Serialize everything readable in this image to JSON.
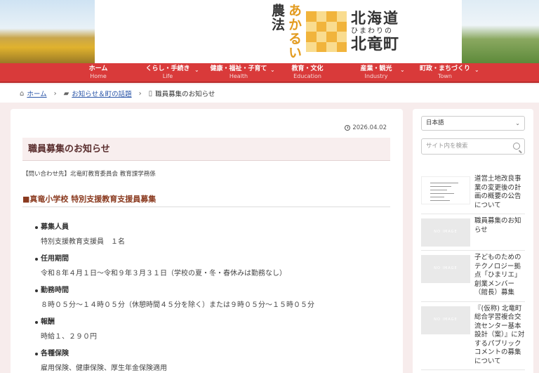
{
  "header": {
    "logo": {
      "vertical_right": "あかるい",
      "vertical_left": "農法",
      "pref": "北海道",
      "sub": "ひまわりの",
      "town": "北竜町"
    }
  },
  "nav": {
    "items": [
      {
        "label": "ホーム",
        "sub": "Home",
        "has_menu": false
      },
      {
        "label": "くらし・手続き",
        "sub": "Life",
        "has_menu": true
      },
      {
        "label": "健康・福祉・子育て",
        "sub": "Health",
        "has_menu": true
      },
      {
        "label": "教育・文化",
        "sub": "Education",
        "has_menu": false
      },
      {
        "label": "産業・観光",
        "sub": "Industry",
        "has_menu": true
      },
      {
        "label": "町政・まちづくり",
        "sub": "Town",
        "has_menu": true
      }
    ],
    "chevron": "⌄"
  },
  "breadcrumb": {
    "home": "ホーム",
    "category": "お知らせ＆町の話題",
    "current": "職員募集のお知らせ"
  },
  "article": {
    "date": "2026.04.02",
    "title": "職員募集のお知らせ",
    "contact": "【問い合わせ先】北竜町教育委員会 教育課学務係",
    "section_heading": "■真竜小学校 特別支援教育支援員募集",
    "items": [
      {
        "label": "募集人員",
        "value": "特別支援教育支援員　１名"
      },
      {
        "label": "任用期間",
        "value": "令和８年４月１日〜令和９年３月３１日（学校の夏・冬・春休みは勤務なし）"
      },
      {
        "label": "勤務時間",
        "value": "８時０５分〜１４時０５分（休憩時間４５分を除く）または９時０５分〜１５時０５分"
      },
      {
        "label": "報酬",
        "value": "時給１、２９０円"
      },
      {
        "label": "各種保険",
        "value": "雇用保険、健康保険、厚生年金保険適用"
      }
    ]
  },
  "sidebar": {
    "language": "日本語",
    "search_placeholder": "サイト内を検索",
    "no_image": "NO IMAGE",
    "posts": [
      {
        "title": "道営土地改良事業の変更後の計画の概要の公告について",
        "thumb": "doc"
      },
      {
        "title": "職員募集のお知らせ",
        "thumb": "none"
      },
      {
        "title": "子どものためのテクノロジー拠点「ひまリエ」創業メンバー（館長）募集",
        "thumb": "none"
      },
      {
        "title": "『(仮称) 北竜町総合学習複合交流センター基本設計（案）』に対するパブリックコメントの募集について",
        "thumb": "none"
      }
    ]
  },
  "colors": {
    "nav_bg": "#d93a3a",
    "title_bg": "#f8eeee",
    "heading": "#8a3a1f",
    "link": "#2a55a8",
    "logo_orange": "#e39b1f"
  }
}
